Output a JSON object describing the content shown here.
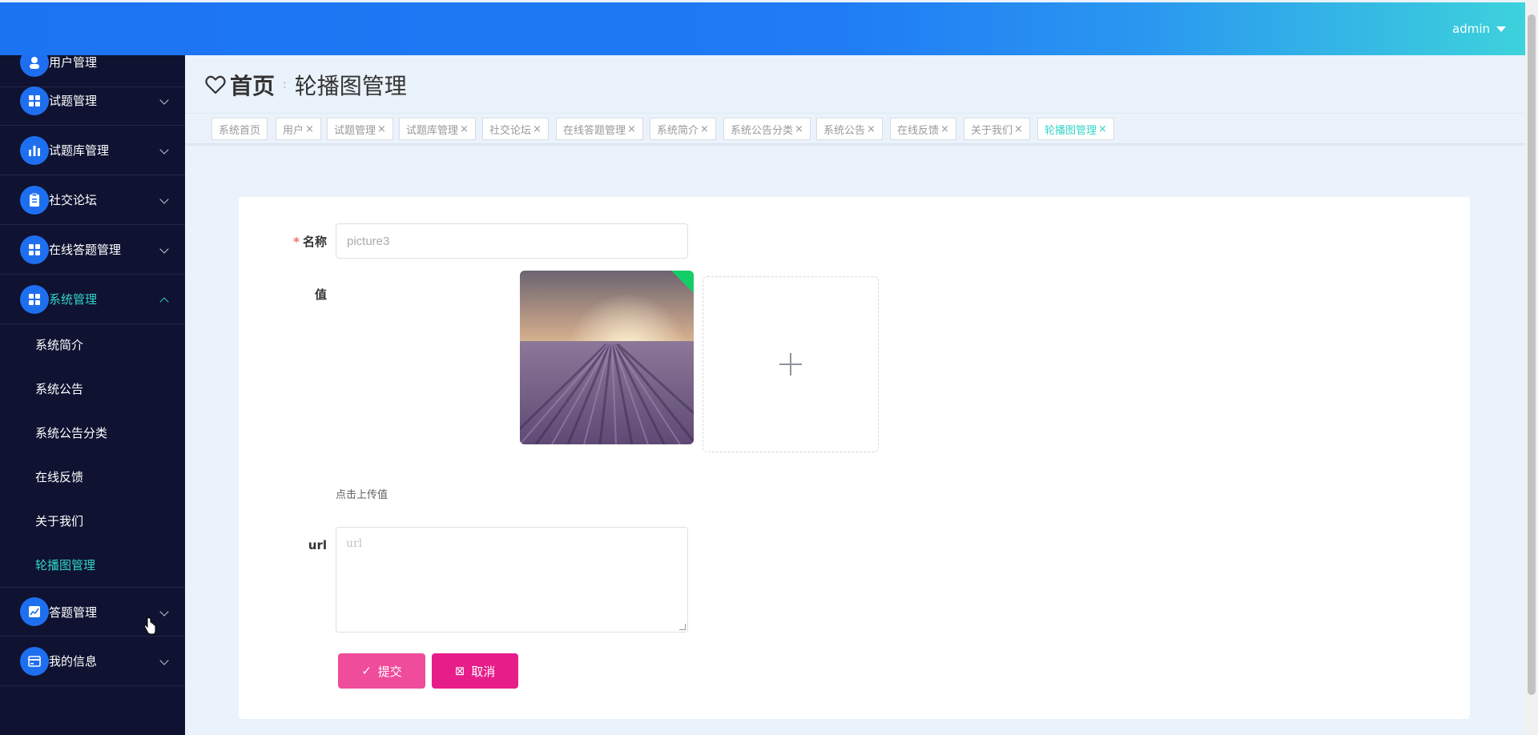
{
  "header": {
    "user": "admin"
  },
  "breadcrumb": {
    "home": "首页",
    "separator": ":",
    "current": "轮播图管理"
  },
  "sidebar": {
    "partial_label": "用户管理",
    "menus": [
      {
        "label": "试题管理",
        "icon": "grid-icon",
        "expanded": false
      },
      {
        "label": "试题库管理",
        "icon": "bar-chart-icon",
        "expanded": false
      },
      {
        "label": "社交论坛",
        "icon": "clipboard-icon",
        "expanded": false
      },
      {
        "label": "在线答题管理",
        "icon": "grid-icon",
        "expanded": false
      },
      {
        "label": "系统管理",
        "icon": "grid-icon",
        "expanded": true
      },
      {
        "label": "答题管理",
        "icon": "line-chart-icon",
        "expanded": false
      },
      {
        "label": "我的信息",
        "icon": "card-icon",
        "expanded": false
      }
    ],
    "submenu": [
      "系统简介",
      "系统公告",
      "系统公告分类",
      "在线反馈",
      "关于我们",
      "轮播图管理"
    ],
    "active_submenu": "轮播图管理"
  },
  "tags": [
    {
      "label": "系统首页",
      "closable": false
    },
    {
      "label": "用户",
      "closable": true
    },
    {
      "label": "试题管理",
      "closable": true
    },
    {
      "label": "试题库管理",
      "closable": true
    },
    {
      "label": "社交论坛",
      "closable": true
    },
    {
      "label": "在线答题管理",
      "closable": true
    },
    {
      "label": "系统简介",
      "closable": true
    },
    {
      "label": "系统公告分类",
      "closable": true
    },
    {
      "label": "系统公告",
      "closable": true
    },
    {
      "label": "在线反馈",
      "closable": true
    },
    {
      "label": "关于我们",
      "closable": true
    },
    {
      "label": "轮播图管理",
      "closable": true,
      "active": true
    }
  ],
  "form": {
    "name_label": "名称",
    "name_value": "picture3",
    "value_label": "值",
    "upload_tip": "点击上传值",
    "url_label": "url",
    "url_placeholder": "url",
    "submit_label": "提交",
    "cancel_label": "取消"
  },
  "colors": {
    "accent": "#33d4c8",
    "sidebar_bg": "#0f1231",
    "icon_bg": "#1e6ff0",
    "submit": "#ef4c9b",
    "cancel": "#e71d89"
  }
}
